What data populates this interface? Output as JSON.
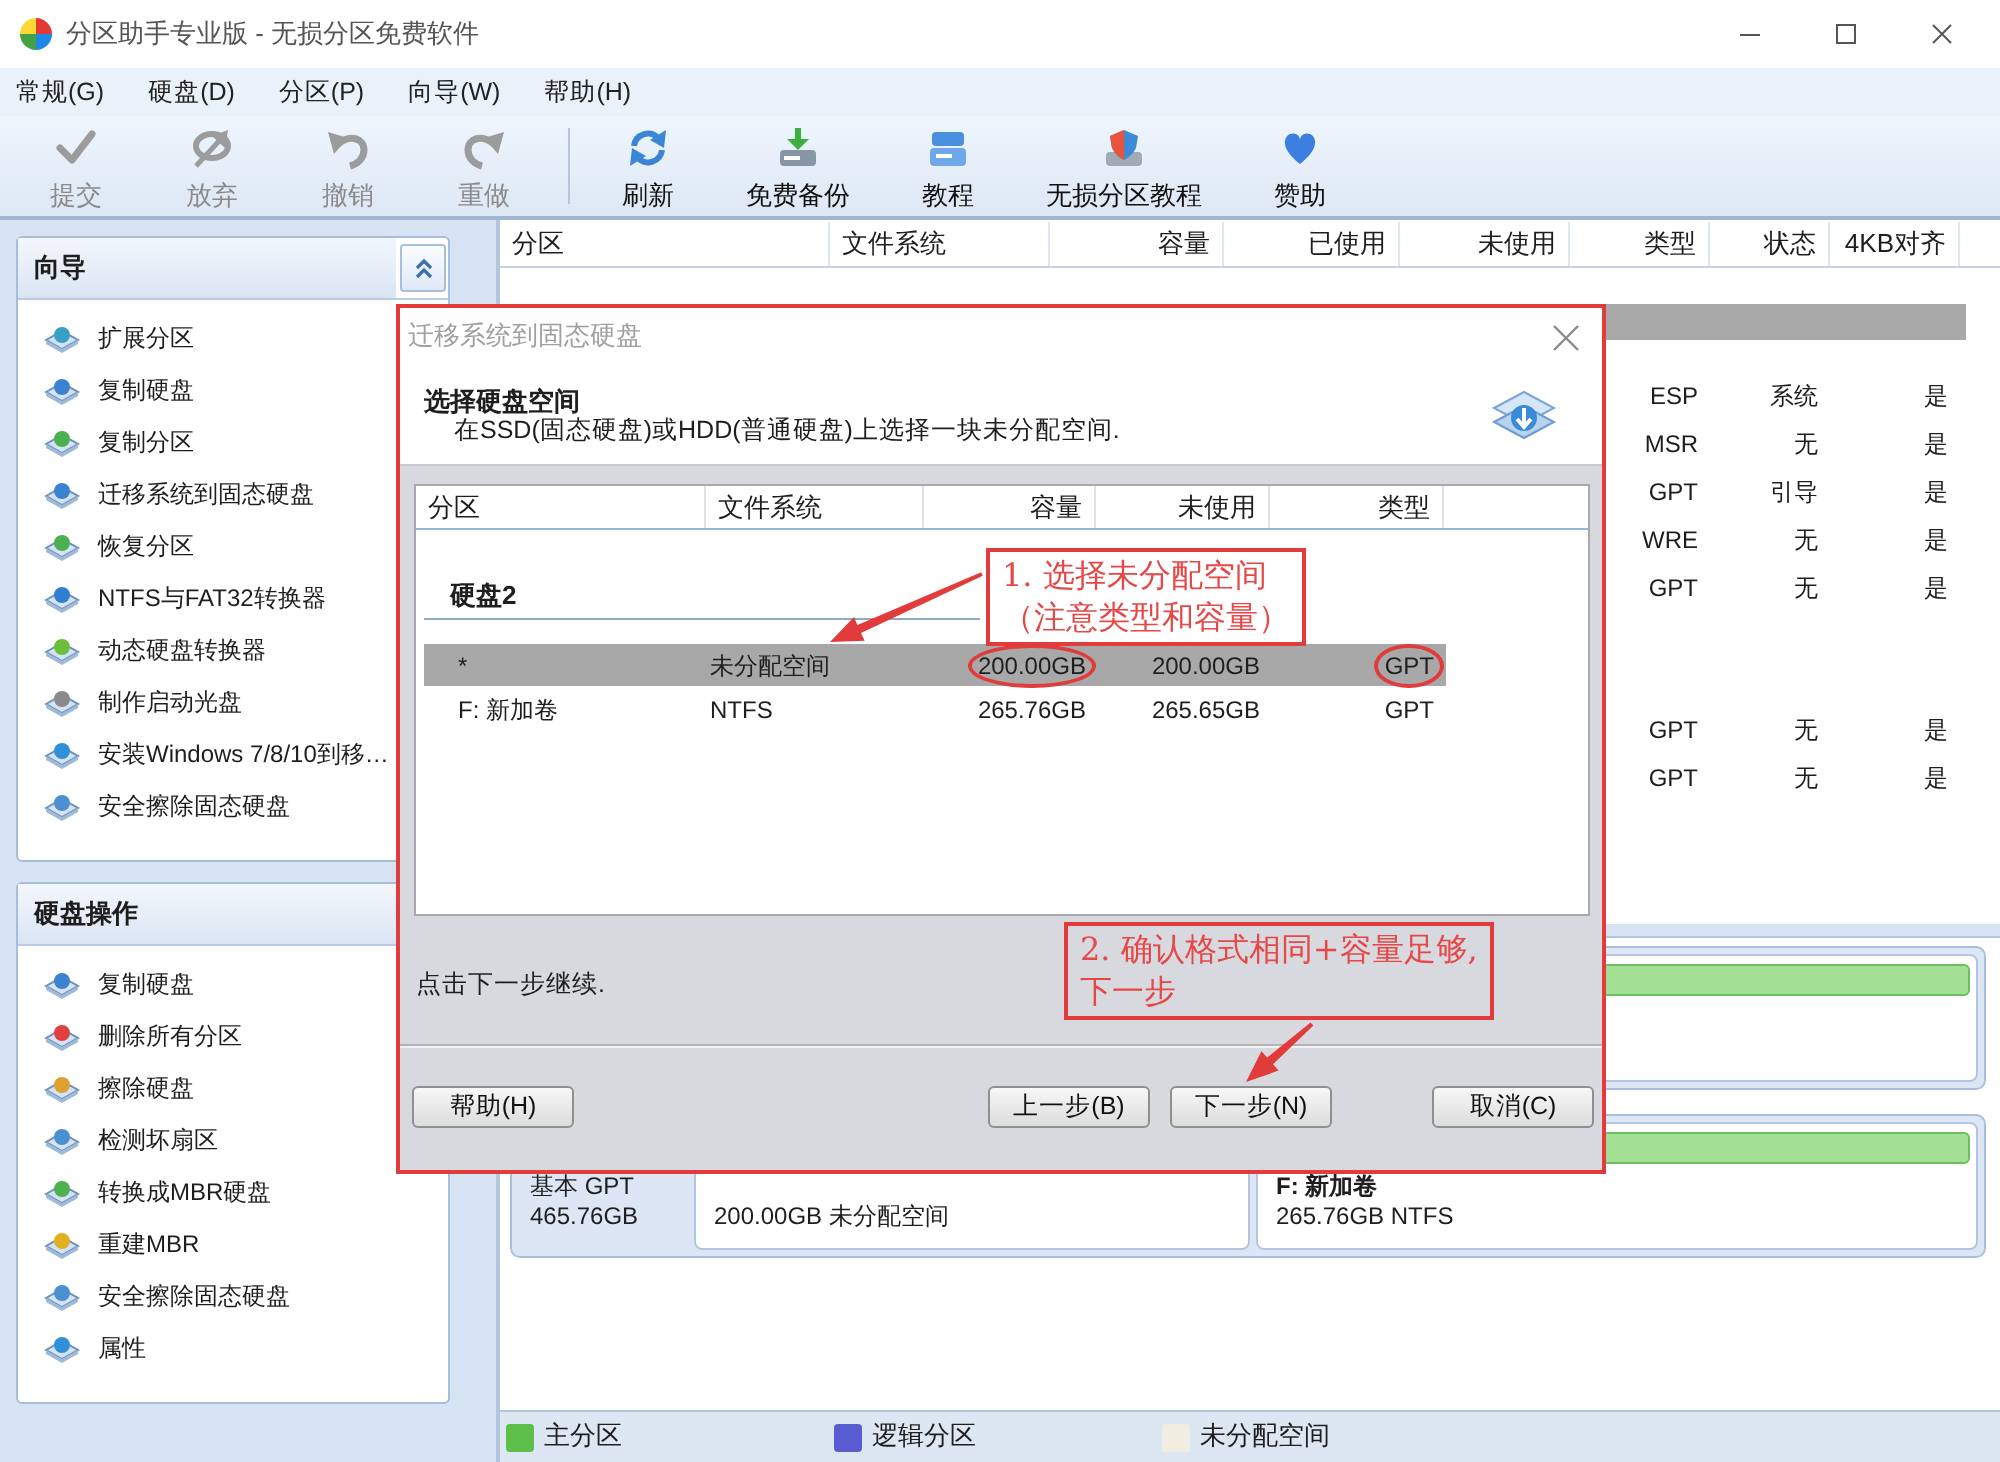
{
  "window": {
    "title": "分区助手专业版 - 无损分区免费软件"
  },
  "menu": [
    "常规(G)",
    "硬盘(D)",
    "分区(P)",
    "向导(W)",
    "帮助(H)"
  ],
  "toolbar": [
    {
      "buttons": [
        {
          "label": "提交",
          "disabled": true
        },
        {
          "label": "放弃",
          "disabled": true
        },
        {
          "label": "撤销",
          "disabled": true
        },
        {
          "label": "重做",
          "disabled": true
        }
      ]
    },
    {
      "buttons": [
        {
          "label": "刷新",
          "disabled": false
        },
        {
          "label": "免费备份",
          "disabled": false
        },
        {
          "label": "教程",
          "disabled": false
        },
        {
          "label": "无损分区教程",
          "disabled": false
        },
        {
          "label": "赞助",
          "disabled": false
        }
      ]
    }
  ],
  "sidebar": {
    "panels": [
      {
        "title": "向导",
        "expanded": true,
        "items": [
          "扩展分区",
          "复制硬盘",
          "复制分区",
          "迁移系统到固态硬盘",
          "恢复分区",
          "NTFS与FAT32转换器",
          "动态硬盘转换器",
          "制作启动光盘",
          "安装Windows 7/8/10到移…",
          "安全擦除固态硬盘"
        ]
      },
      {
        "title": "硬盘操作",
        "expanded": true,
        "items": [
          "复制硬盘",
          "删除所有分区",
          "擦除硬盘",
          "检测坏扇区",
          "转换成MBR硬盘",
          "重建MBR",
          "安全擦除固态硬盘",
          "属性"
        ]
      }
    ]
  },
  "table": {
    "columns": [
      "分区",
      "文件系统",
      "容量",
      "已使用",
      "未使用",
      "类型",
      "状态",
      "4KB对齐"
    ],
    "rows": [
      {
        "kind": "disk",
        "selected": true
      },
      {
        "kind": "partition",
        "type": "ESP",
        "status": "系统",
        "aligned_4kb": "是"
      },
      {
        "kind": "partition",
        "type": "MSR",
        "status": "无",
        "aligned_4kb": "是"
      },
      {
        "kind": "partition",
        "type": "GPT",
        "status": "引导",
        "aligned_4kb": "是"
      },
      {
        "kind": "partition",
        "type": "WRE",
        "status": "无",
        "aligned_4kb": "是"
      },
      {
        "kind": "partition",
        "type": "GPT",
        "status": "无",
        "aligned_4kb": "是"
      },
      {
        "kind": "disk",
        "selected": false
      },
      {
        "kind": "partition",
        "type": "GPT",
        "status": "无",
        "aligned_4kb": "是"
      },
      {
        "kind": "partition",
        "type": "GPT",
        "status": "无",
        "aligned_4kb": "是"
      }
    ]
  },
  "disk_map": {
    "disks": [
      {
        "partitions": [
          {
            "kind": "primary"
          }
        ]
      },
      {
        "label": "基本 GPT",
        "size": "465.76GB",
        "partitions": [
          {
            "kind": "unallocated",
            "info": "200.00GB 未分配空间"
          },
          {
            "kind": "primary",
            "name": "F: 新加卷",
            "info": "265.76GB NTFS"
          }
        ]
      }
    ]
  },
  "legend": [
    {
      "label": "主分区",
      "color": "#5cbf4a"
    },
    {
      "label": "逻辑分区",
      "color": "#5a5ad2"
    },
    {
      "label": "未分配空间",
      "color": "#f1ede1"
    }
  ],
  "dialog": {
    "title": "迁移系统到固态硬盘",
    "heading": "选择硬盘空间",
    "subtitle": "在SSD(固态硬盘)或HDD(普通硬盘)上选择一块未分配空间.",
    "list": {
      "columns": [
        "分区",
        "文件系统",
        "容量",
        "未使用",
        "类型"
      ],
      "groups": [
        {
          "title": "硬盘2",
          "rows": [
            {
              "selected": true,
              "cells": [
                {
                  "text": "*",
                  "circled": false
                },
                {
                  "text": "未分配空间",
                  "circled": false
                },
                {
                  "text": "200.00GB",
                  "circled": true
                },
                {
                  "text": "200.00GB",
                  "circled": false
                },
                {
                  "text": "GPT",
                  "circled": true
                }
              ]
            },
            {
              "selected": false,
              "cells": [
                {
                  "text": "F: 新加卷",
                  "circled": false
                },
                {
                  "text": "NTFS",
                  "circled": false
                },
                {
                  "text": "265.76GB",
                  "circled": false
                },
                {
                  "text": "265.65GB",
                  "circled": false
                },
                {
                  "text": "GPT",
                  "circled": false
                }
              ]
            }
          ]
        }
      ]
    },
    "hint": "点击下一步继续.",
    "buttons": [
      {
        "label": "帮助(H)"
      },
      {
        "label": "上一步(B)"
      },
      {
        "label": "下一步(N)"
      },
      {
        "label": "取消(C)"
      }
    ]
  },
  "annotations": [
    {
      "kind": "frame"
    },
    {
      "kind": "callout",
      "lines": [
        "1. 选择未分配空间",
        "（注意类型和容量）"
      ]
    },
    {
      "kind": "callout",
      "lines": [
        "2. 确认格式相同+容量足够,",
        "下一步"
      ]
    }
  ]
}
